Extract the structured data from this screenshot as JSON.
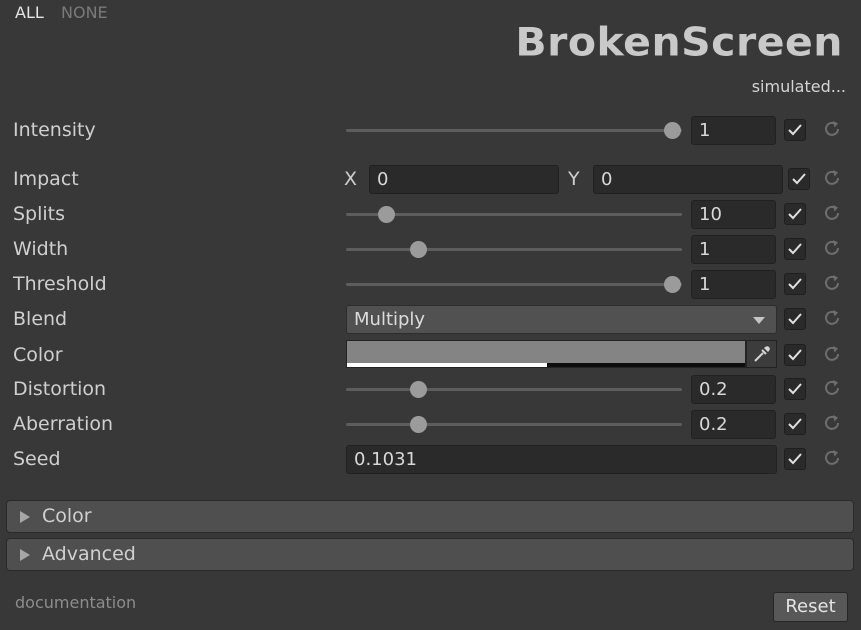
{
  "header": {
    "all_label": "ALL",
    "none_label": "NONE",
    "logo_text": "BrokenScreen",
    "status_text": "simulated..."
  },
  "params": {
    "intensity": {
      "label": "Intensity",
      "value": "1",
      "slider_fraction": 1.0,
      "enabled": true
    },
    "impact": {
      "label": "Impact",
      "x_label": "X",
      "x_value": "0",
      "y_label": "Y",
      "y_value": "0",
      "enabled": true
    },
    "splits": {
      "label": "Splits",
      "value": "10",
      "slider_fraction": 0.12,
      "enabled": true
    },
    "width": {
      "label": "Width",
      "value": "1",
      "slider_fraction": 0.22,
      "enabled": true
    },
    "threshold": {
      "label": "Threshold",
      "value": "1",
      "slider_fraction": 1.0,
      "enabled": true
    },
    "blend": {
      "label": "Blend",
      "value": "Multiply",
      "enabled": true
    },
    "color": {
      "label": "Color",
      "hex": "#848484",
      "alpha_fraction": 0.5,
      "enabled": true
    },
    "distortion": {
      "label": "Distortion",
      "value": "0.2",
      "slider_fraction": 0.22,
      "enabled": true
    },
    "aberration": {
      "label": "Aberration",
      "value": "0.2",
      "slider_fraction": 0.22,
      "enabled": true
    },
    "seed": {
      "label": "Seed",
      "value": "0.1031",
      "enabled": true
    }
  },
  "sections": {
    "color": {
      "label": "Color",
      "expanded": false
    },
    "advanced": {
      "label": "Advanced",
      "expanded": false
    }
  },
  "footer": {
    "documentation_label": "documentation",
    "reset_label": "Reset"
  },
  "icons": {
    "check": "checkmark-icon",
    "reset": "reset-icon",
    "eyedropper": "eyedropper-icon",
    "dropdown": "chevron-down-icon",
    "foldout": "triangle-right-icon"
  }
}
